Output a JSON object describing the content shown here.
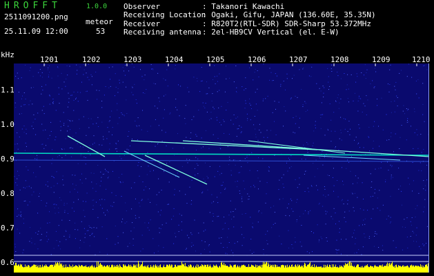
{
  "header": {
    "app_title": "HROFFT",
    "version": "1.0.0",
    "file_name": "2511091200.png",
    "meteor_label": "meteor",
    "datetime": "25.11.09 12:00",
    "meteor_count": "53"
  },
  "info": [
    {
      "key": "Observer",
      "value": ": Takanori Kawachi"
    },
    {
      "key": "Receiving Location",
      "value": ": Ogaki, Gifu, JAPAN (136.60E, 35.35N)"
    },
    {
      "key": "Receiver",
      "value": ": R820T2(RTL-SDR) SDR-Sharp 53.372MHz"
    },
    {
      "key": "Receiving antenna",
      "value": ": 2el-HB9CV Vertical (el. E-W)"
    }
  ],
  "axes": {
    "y_unit": "kHz",
    "x_ticks": [
      "1201",
      "1202",
      "1203",
      "1204",
      "1205",
      "1206",
      "1207",
      "1208",
      "1209",
      "1210"
    ],
    "y_ticks": [
      "1.1",
      "1.0",
      "0.9",
      "0.8",
      "0.7",
      "0.6"
    ]
  },
  "colors": {
    "background": "#0a0a6e",
    "carrier": "#00ffd0",
    "meteor_trace": "#80ffe0",
    "label_text": "#ffffff",
    "title_green": "#3bd63b",
    "noise_bar": "#ffff00"
  }
}
